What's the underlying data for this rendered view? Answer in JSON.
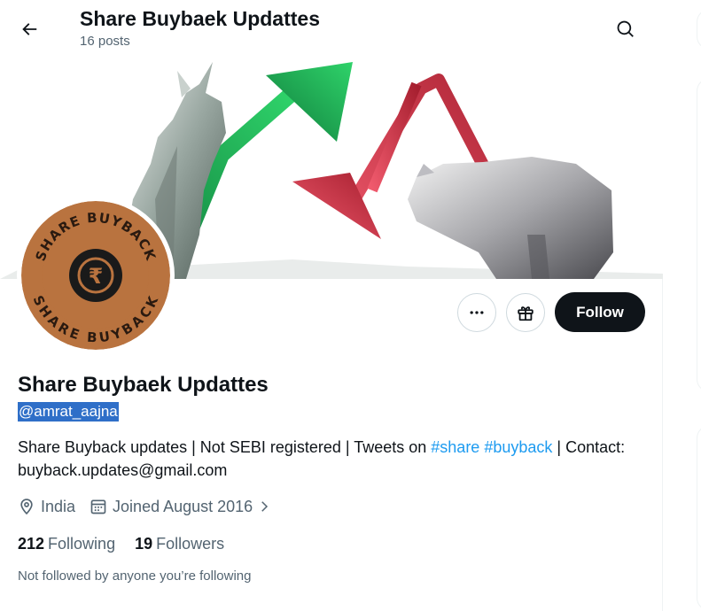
{
  "header": {
    "title": "Share Buybaek Updattes",
    "posts": "16 posts"
  },
  "avatar": {
    "top_text": "SHARE BUYBACK",
    "bottom_text": "SHARE BUYBACK",
    "symbol": "₹"
  },
  "actions": {
    "follow_label": "Follow"
  },
  "profile": {
    "name": "Share Buybaek Updattes",
    "handle": "@amrat_aajna",
    "bio": {
      "text_before": "Share Buyback updates | Not SEBI registered | Tweets on ",
      "tag1": "#share",
      "tag2": "#buyback",
      "text_after": " | Contact: buyback.updates@gmail.com"
    },
    "location": "India",
    "joined": "Joined August 2016",
    "following_count": "212",
    "following_label": "Following",
    "followers_count": "19",
    "followers_label": "Followers",
    "not_followed": "Not followed by anyone you’re following"
  },
  "icons": {
    "back": "arrow-left-icon",
    "search": "search-icon",
    "more": "more-horizontal-icon",
    "gift": "gift-icon",
    "location": "location-pin-icon",
    "calendar": "calendar-icon",
    "chevron": "chevron-right-icon"
  },
  "colors": {
    "accent": "#1d9bf0",
    "follow_bg": "#0f1419",
    "avatar_brown": "#b9733f",
    "up_arrow": "#1fb75a",
    "down_arrow": "#e0445a"
  }
}
